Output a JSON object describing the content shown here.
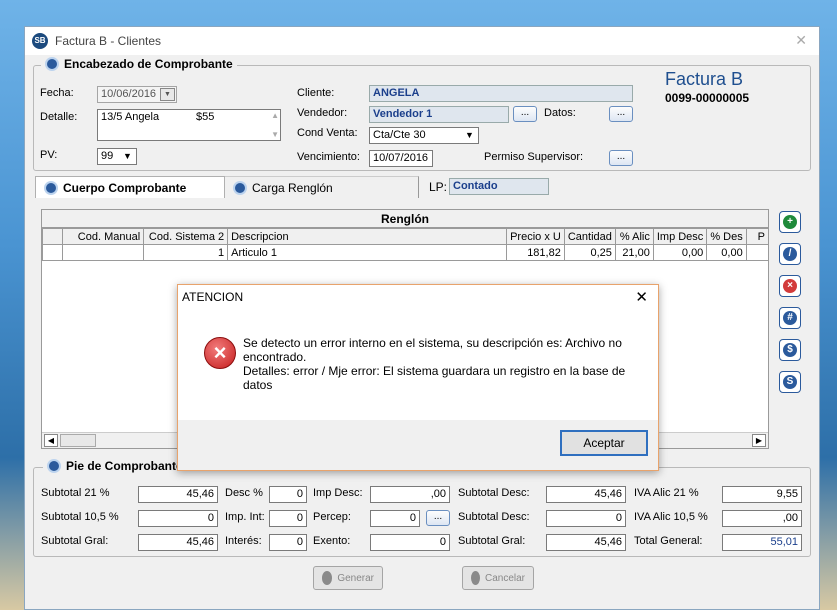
{
  "window": {
    "title": "Factura B - Clientes",
    "close_symbol": "✕"
  },
  "header": {
    "group_title": "Encabezado de Comprobante",
    "fecha_label": "Fecha:",
    "fecha_value": "10/06/2016",
    "detalle_label": "Detalle:",
    "detalle_text": "13/5 Angela",
    "detalle_amount": "$55",
    "pv_label": "PV:",
    "pv_value": "99",
    "cliente_label": "Cliente:",
    "cliente_value": "ANGELA",
    "vendedor_label": "Vendedor:",
    "vendedor_value": "Vendedor 1",
    "datos_label": "Datos:",
    "condventa_label": "Cond Venta:",
    "condventa_value": "Cta/Cte 30",
    "vencimiento_label": "Vencimiento:",
    "vencimiento_value": "10/07/2016",
    "permiso_label": "Permiso Supervisor:",
    "ellipsis": "...",
    "invoice_type": "Factura B",
    "invoice_number": "0099-00000005"
  },
  "tabs": [
    {
      "label": "Cuerpo Comprobante",
      "active": true
    },
    {
      "label": "Carga Renglón",
      "active": false
    }
  ],
  "lp": {
    "label": "LP:",
    "value": "Contado"
  },
  "grid": {
    "caption": "Renglón",
    "columns": [
      "Cod. Manual",
      "Cod. Sistema 2",
      "Descripcion",
      "Precio x U",
      "Cantidad",
      "% Alic",
      "Imp Desc",
      "% Des",
      "P"
    ],
    "rows": [
      [
        "",
        "1",
        "Articulo 1",
        "181,82",
        "0,25",
        "21,00",
        "0,00",
        "0,00",
        ""
      ]
    ]
  },
  "dialog": {
    "title": "ATENCION",
    "close_symbol": "✕",
    "line1": "Se detecto un error interno en el sistema, su descripción es: Archivo no encontrado.",
    "line2": "Detalles: error / Mje error:  El sistema guardara un registro en la base de datos",
    "ok_label": "Aceptar"
  },
  "footer": {
    "group_title": "Pie de Comprobante",
    "subtotal21_label": "Subtotal  21 %",
    "subtotal21_value": "45,46",
    "subtotal105_label": "Subtotal  10,5 %",
    "subtotal105_value": "0",
    "subtotalgral_label": "Subtotal Gral:",
    "subtotalgral_value": "45,46",
    "desc_label": "Desc %",
    "desc_value": "0",
    "impint_label": "Imp. Int:",
    "impint_value": "0",
    "interes_label": "Interés:",
    "interes_value": "0",
    "impdesc_label": "Imp Desc:",
    "impdesc_value": ",00",
    "percep_label": "Percep:",
    "percep_value": "0",
    "exento_label": "Exento:",
    "exento_value": "0",
    "subdesc1_label": "Subtotal Desc:",
    "subdesc1_value": "45,46",
    "subdesc2_label": "Subtotal Desc:",
    "subdesc2_value": "0",
    "subgral2_label": "Subtotal Gral:",
    "subgral2_value": "45,46",
    "iva21_label": "IVA Alic  21 %",
    "iva21_value": "9,55",
    "iva105_label": "IVA Alic  10,5 %",
    "iva105_value": ",00",
    "total_label": "Total General:",
    "total_value": "55,01"
  },
  "actions": {
    "generar_label": "Generar",
    "cancelar_label": "Cancelar"
  }
}
